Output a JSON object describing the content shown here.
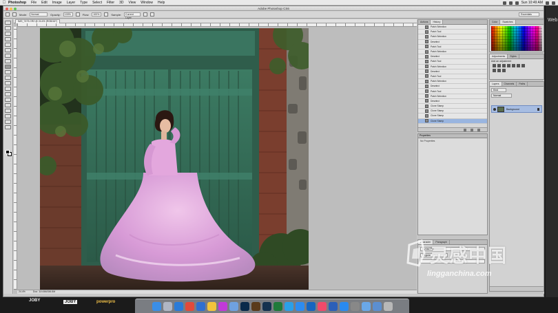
{
  "menubar": {
    "app": "Photoshop",
    "items": [
      "File",
      "Edit",
      "Image",
      "Layer",
      "Type",
      "Select",
      "Filter",
      "3D",
      "View",
      "Window",
      "Help"
    ],
    "clock": "Sun 10:49 AM"
  },
  "window": {
    "title": "Adobe Photoshop CS6"
  },
  "options": {
    "mode_label": "Mode:",
    "mode_value": "Normal",
    "opacity_label": "Opacity:",
    "opacity_value": "100%",
    "flow_label": "Flow:",
    "flow_value": "100%",
    "sample_label": "Sample:",
    "sample_value": "Current Layer",
    "workspace": "Essentials"
  },
  "document": {
    "tab": "IMG_7473.CR2 @ 24.4% (RGB/16*)",
    "zoom": "24.4%",
    "doc_size": "Doc: 119.8M/156.5M"
  },
  "history": {
    "tabs": [
      "Actions",
      "History"
    ],
    "active_tab": 1,
    "items": [
      "Patch Selection",
      "Patch Tool",
      "Patch Selection",
      "Deselect",
      "Patch Tool",
      "Patch Selection",
      "Deselect",
      "Patch Tool",
      "Patch Selection",
      "Deselect",
      "Patch Tool",
      "Patch Selection",
      "Deselect",
      "Patch Tool",
      "Patch Selection",
      "Deselect",
      "Clone Stamp",
      "Clone Stamp",
      "Clone Stamp",
      "Clone Stamp"
    ],
    "current_index": 19
  },
  "properties": {
    "title": "Properties",
    "empty_text": "No Properties"
  },
  "character": {
    "tabs": [
      "Character",
      "Paragraph"
    ],
    "font": "Myriad Pro",
    "style": "Regular"
  },
  "swatches": {
    "tabs": [
      "Color",
      "Swatches"
    ]
  },
  "adjustments": {
    "tabs": [
      "Adjustments",
      "Styles"
    ],
    "hint": "Add an adjustment"
  },
  "layers": {
    "tabs": [
      "Layers",
      "Channels",
      "Paths"
    ],
    "kind": "Kind",
    "blend": "Normal",
    "opacity_label": "Opacity:",
    "opacity": "100%",
    "row_name": "Background"
  },
  "watermark": {
    "cn": "灵感中国",
    "url": "lingganchina.com"
  },
  "background": {
    "brands": [
      "JOBY",
      "JOBY",
      "powerpro"
    ],
    "right_text": "Web"
  },
  "dock": {
    "icons": [
      "finder-icon",
      "launchpad-icon",
      "safari-icon",
      "chrome-icon",
      "mail-icon",
      "photos-icon",
      "itunes-icon",
      "preview-icon",
      "photoshop-icon",
      "bridge-icon",
      "lightroom-icon",
      "excel-icon",
      "skype-icon",
      "zoom-icon",
      "outlook-icon",
      "music-icon",
      "word-icon",
      "appstore-icon",
      "capture-icon",
      "folder-icon",
      "downloads-icon",
      "trash-icon"
    ],
    "colors": [
      "#3a8ee6",
      "#b0b6c4",
      "#2a7bd8",
      "#e24a3a",
      "#2f6fd0",
      "#f2c43c",
      "#c23ad8",
      "#6fa1e0",
      "#0a2a4a",
      "#5a3a1a",
      "#14314f",
      "#1f7a3a",
      "#2aa0e8",
      "#2d8cf0",
      "#1565c0",
      "#f04a6a",
      "#2b5fb8",
      "#2a8af0",
      "#888888",
      "#6aa8e8",
      "#5c8fd0",
      "#b8b8b8"
    ]
  }
}
